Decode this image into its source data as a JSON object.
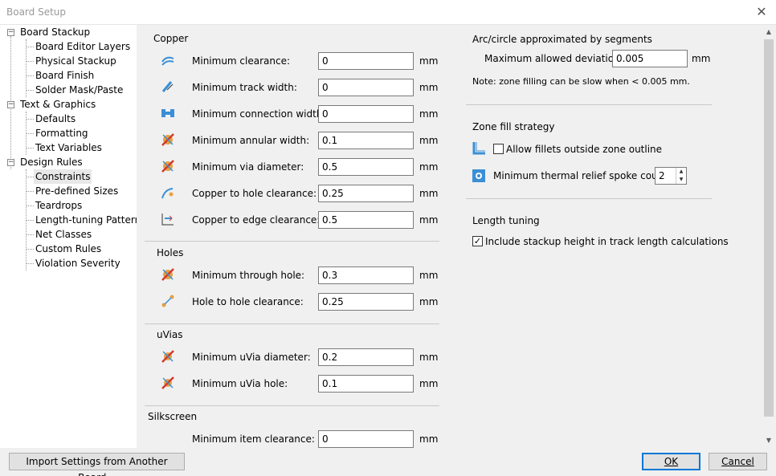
{
  "window": {
    "title": "Board Setup"
  },
  "tree": {
    "board_stackup": "Board Stackup",
    "board_editor_layers": "Board Editor Layers",
    "physical_stackup": "Physical Stackup",
    "board_finish": "Board Finish",
    "solder_mask_paste": "Solder Mask/Paste",
    "text_graphics": "Text & Graphics",
    "defaults": "Defaults",
    "formatting": "Formatting",
    "text_variables": "Text Variables",
    "design_rules": "Design Rules",
    "constraints": "Constraints",
    "predefined_sizes": "Pre-defined Sizes",
    "teardrops": "Teardrops",
    "length_tuning_patterns": "Length-tuning Patterns",
    "net_classes": "Net Classes",
    "custom_rules": "Custom Rules",
    "violation_severity": "Violation Severity"
  },
  "copper": {
    "title": "Copper",
    "min_clearance": {
      "label": "Minimum clearance:",
      "value": "0",
      "unit": "mm"
    },
    "min_track_width": {
      "label": "Minimum track width:",
      "value": "0",
      "unit": "mm"
    },
    "min_connection_width": {
      "label": "Minimum connection width:",
      "value": "0",
      "unit": "mm"
    },
    "min_annular_width": {
      "label": "Minimum annular width:",
      "value": "0.1",
      "unit": "mm"
    },
    "min_via_diameter": {
      "label": "Minimum via diameter:",
      "value": "0.5",
      "unit": "mm"
    },
    "copper_to_hole": {
      "label": "Copper to hole clearance:",
      "value": "0.25",
      "unit": "mm"
    },
    "copper_to_edge": {
      "label": "Copper to edge clearance:",
      "value": "0.5",
      "unit": "mm"
    }
  },
  "holes": {
    "title": "Holes",
    "min_through_hole": {
      "label": "Minimum through hole:",
      "value": "0.3",
      "unit": "mm"
    },
    "hole_to_hole": {
      "label": "Hole to hole clearance:",
      "value": "0.25",
      "unit": "mm"
    }
  },
  "uvias": {
    "title": "uVias",
    "min_uvia_diameter": {
      "label": "Minimum uVia diameter:",
      "value": "0.2",
      "unit": "mm"
    },
    "min_uvia_hole": {
      "label": "Minimum uVia hole:",
      "value": "0.1",
      "unit": "mm"
    }
  },
  "silkscreen": {
    "title": "Silkscreen",
    "min_item_clearance": {
      "label": "Minimum item clearance:",
      "value": "0",
      "unit": "mm"
    }
  },
  "arc": {
    "title": "Arc/circle approximated by segments",
    "max_deviation": {
      "label": "Maximum allowed deviation:",
      "value": "0.005",
      "unit": "mm"
    },
    "note": "Note: zone filling can be slow when < 0.005 mm."
  },
  "zone": {
    "title": "Zone fill strategy",
    "allow_fillets": {
      "label": "Allow fillets outside zone outline",
      "checked": ""
    },
    "thermal_spoke": {
      "label": "Minimum thermal relief spoke count:",
      "value": "2"
    }
  },
  "length": {
    "title": "Length tuning",
    "include_stackup": {
      "label": "Include stackup height in track length calculations",
      "checked": "✓"
    }
  },
  "footer": {
    "import_label": "Import Settings from Another Board...",
    "ok_label": "OK",
    "cancel_label": "Cancel"
  },
  "colors": {
    "accent": "#0078d7",
    "icon_blue": "#3a8fd6",
    "icon_red": "#d03a2b",
    "icon_orange": "#e8a040"
  }
}
